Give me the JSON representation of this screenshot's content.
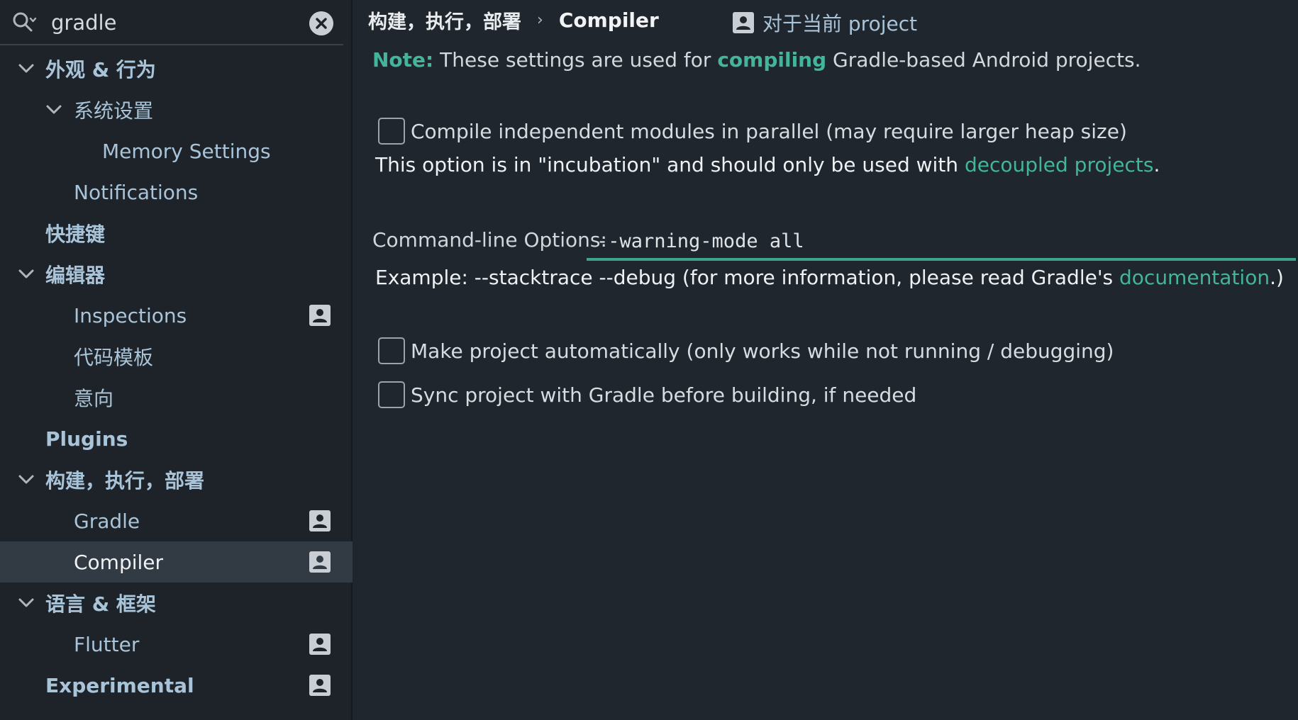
{
  "search": {
    "value": "gradle",
    "icon": "search-icon",
    "clear_icon": "close-circle-icon"
  },
  "sidebar": {
    "items": [
      {
        "label": "外观 & 行为",
        "expanded": true
      },
      {
        "label": "系统设置",
        "expanded": true
      },
      {
        "label": "Memory Settings"
      },
      {
        "label": "Notifications"
      },
      {
        "label": "快捷键"
      },
      {
        "label": "编辑器",
        "expanded": true
      },
      {
        "label": "Inspections",
        "project_scope": true
      },
      {
        "label": "代码模板"
      },
      {
        "label": "意向"
      },
      {
        "label": "Plugins"
      },
      {
        "label": "构建，执行，部署",
        "expanded": true
      },
      {
        "label": "Gradle",
        "project_scope": true
      },
      {
        "label": "Compiler",
        "project_scope": true,
        "selected": true
      },
      {
        "label": "语言 & 框架",
        "expanded": true
      },
      {
        "label": "Flutter",
        "project_scope": true
      },
      {
        "label": "Experimental",
        "project_scope": true
      }
    ]
  },
  "header": {
    "breadcrumb_parent": "构建，执行，部署",
    "breadcrumb_separator": "›",
    "breadcrumb_current": "Compiler",
    "scope_label": "对于当前 project"
  },
  "note": {
    "label": "Note:",
    "text_before": " These settings are used for ",
    "link": "compiling",
    "text_after": " Gradle-based Android projects."
  },
  "options": {
    "parallel": {
      "label": "Compile independent modules in parallel (may require larger heap size)",
      "checked": false
    },
    "incubation": {
      "text": "This option is in \"incubation\" and should only be used with ",
      "link": "decoupled projects",
      "suffix": "."
    },
    "command_line": {
      "label": "Command-line Options:",
      "value": "--warning-mode all"
    },
    "example": {
      "text": "Example: --stacktrace --debug (for more information, please read Gradle's ",
      "link": "documentation",
      "suffix": ".)"
    },
    "make_auto": {
      "label": "Make project automatically (only works while not running / debugging)",
      "checked": false
    },
    "sync": {
      "label": "Sync project with Gradle before building, if needed",
      "checked": false
    }
  },
  "colors": {
    "accent": "#42b59b",
    "background": "#1f262d",
    "sidebar_bg": "#1d2329",
    "selection": "#323a43"
  }
}
